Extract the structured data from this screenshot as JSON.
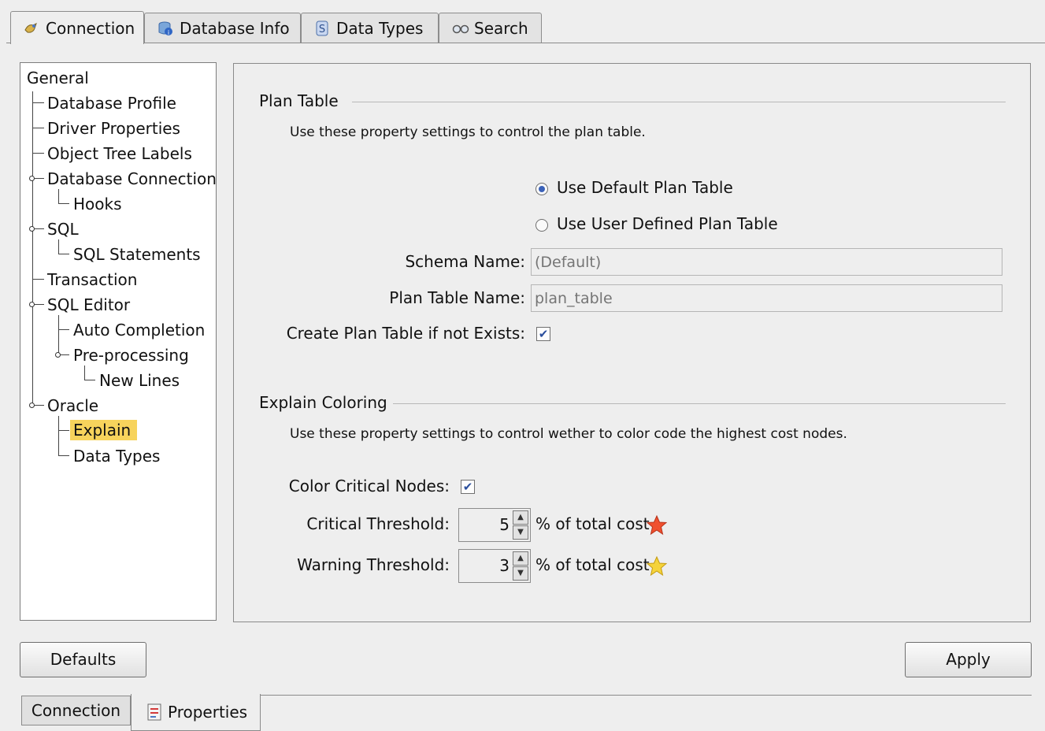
{
  "top_tabs": [
    {
      "label": "Connection",
      "icon": "connection-icon",
      "active": true
    },
    {
      "label": "Database Info",
      "icon": "database-info-icon",
      "active": false
    },
    {
      "label": "Data Types",
      "icon": "data-types-icon",
      "active": false
    },
    {
      "label": "Search",
      "icon": "search-icon",
      "active": false
    }
  ],
  "tree": {
    "items": [
      {
        "label": "General"
      },
      {
        "label": "Database Profile"
      },
      {
        "label": "Driver Properties"
      },
      {
        "label": "Object Tree Labels"
      },
      {
        "label": "Database Connection"
      },
      {
        "label": "Hooks"
      },
      {
        "label": "SQL"
      },
      {
        "label": "SQL Statements"
      },
      {
        "label": "Transaction"
      },
      {
        "label": "SQL Editor"
      },
      {
        "label": "Auto Completion"
      },
      {
        "label": "Pre-processing"
      },
      {
        "label": "New Lines"
      },
      {
        "label": "Oracle"
      },
      {
        "label": "Explain",
        "selected": true
      },
      {
        "label": "Data Types"
      }
    ]
  },
  "plan_table": {
    "title": "Plan Table",
    "description": "Use these property settings to control the plan table.",
    "radio_default": "Use Default Plan Table",
    "radio_user": "Use User Defined Plan Table",
    "selected": "default",
    "schema_label": "Schema Name:",
    "schema_placeholder": "(Default)",
    "table_label": "Plan Table Name:",
    "table_placeholder": "plan_table",
    "create_label": "Create Plan Table if not Exists:",
    "create_checked": true
  },
  "explain_coloring": {
    "title": "Explain Coloring",
    "description": "Use these property settings to control wether to color code the highest cost nodes.",
    "color_label": "Color Critical Nodes:",
    "color_checked": true,
    "critical_label": "Critical Threshold:",
    "critical_value": "5",
    "warning_label": "Warning Threshold:",
    "warning_value": "3",
    "unit": "% of total cost",
    "critical_icon": "red-star-icon",
    "warning_icon": "yellow-star-icon"
  },
  "buttons": {
    "defaults": "Defaults",
    "apply": "Apply"
  },
  "bottom_tabs": [
    {
      "label": "Connection",
      "active": false
    },
    {
      "label": "Properties",
      "icon": "properties-icon",
      "active": true
    }
  ],
  "colors": {
    "selection": "#f7d35c",
    "checkmark": "#2b4f9d",
    "radio_dot": "#3b62b8",
    "critical_star": "#f0502f",
    "warning_star": "#f5d33a"
  }
}
